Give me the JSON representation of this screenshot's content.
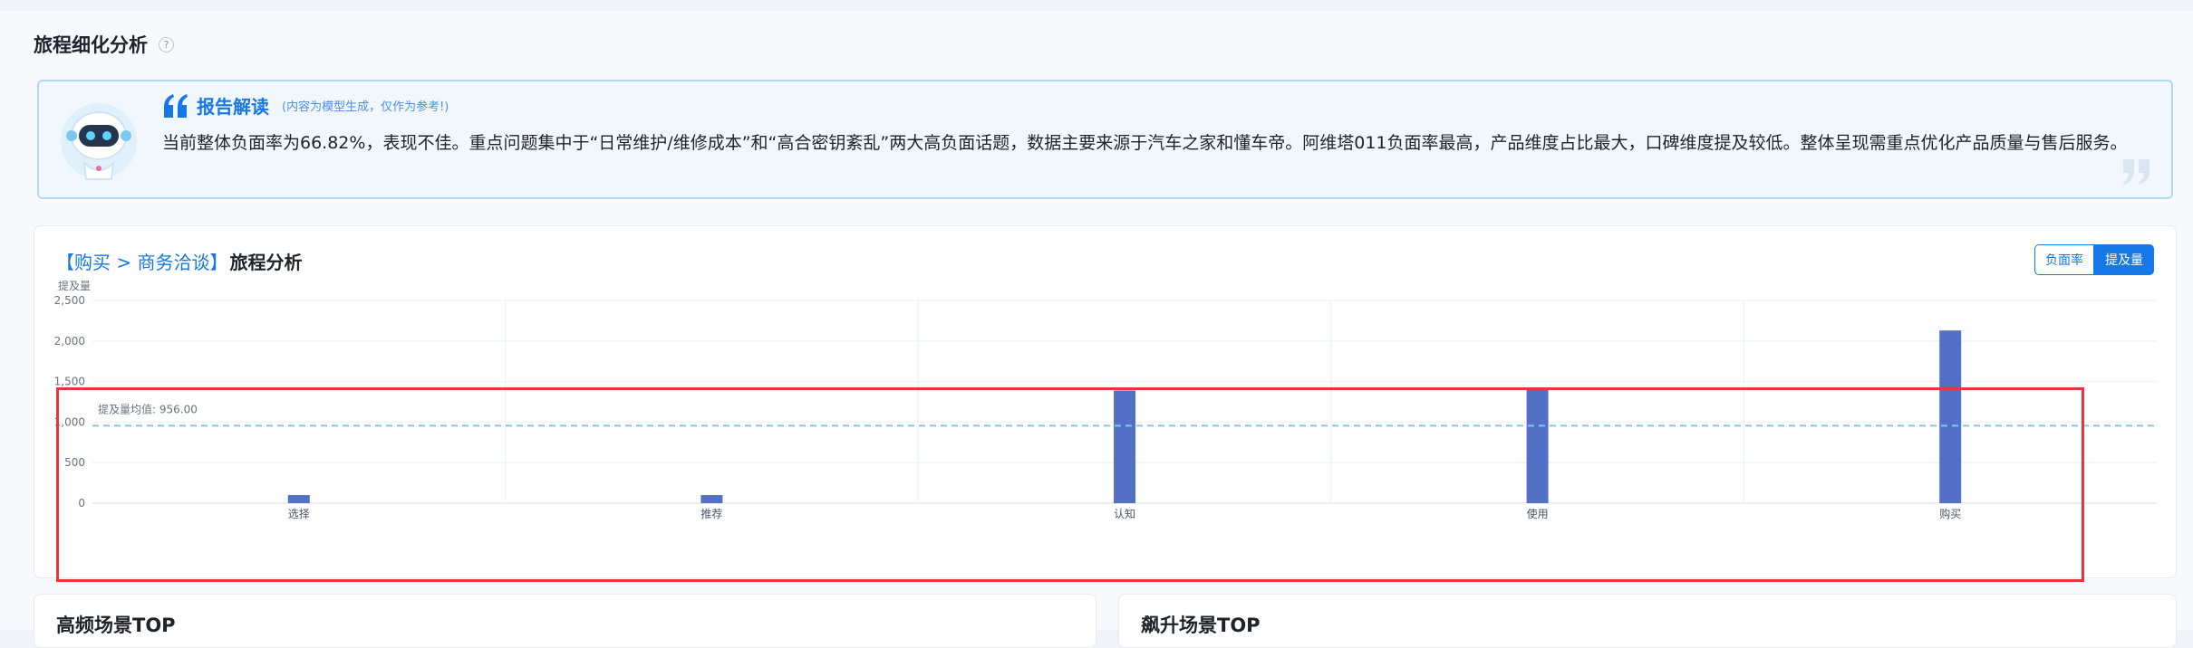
{
  "section": {
    "title": "旅程细化分析",
    "help": "?"
  },
  "report": {
    "title": "报告解读",
    "note": "(内容为模型生成，仅作为参考!)",
    "body": "当前整体负面率为66.82%，表现不佳。重点问题集中于“日常维护/维修成本”和“高合密钥紊乱”两大高负面话题，数据主要来源于汽车之家和懂车帝。阿维塔011负面率最高，产品维度占比最大，口碑维度提及较低。整体呈现需重点优化产品质量与售后服务。"
  },
  "chart_card": {
    "title_link": "【购买 > 商务洽谈】",
    "title_main": "旅程分析",
    "toggle": {
      "negative_rate": "负面率",
      "mentions": "提及量",
      "selected": "提及量"
    }
  },
  "chart_data": {
    "type": "bar",
    "ylabel": "提及量",
    "categories": [
      "选择",
      "推荐",
      "认知",
      "使用",
      "购买"
    ],
    "values": [
      100,
      100,
      1390,
      1410,
      2130
    ],
    "ylim": [
      0,
      2500
    ],
    "yticks": [
      0,
      500,
      1000,
      1500,
      2000,
      2500
    ],
    "ytick_labels": [
      "0",
      "500",
      "1,000",
      "1,500",
      "2,000",
      "2,500"
    ],
    "mean_line": {
      "value": 956,
      "label": "提及量均值: 956.00"
    },
    "bar_color": "#5470c6",
    "mean_color": "#7ec8e8",
    "grid": true
  },
  "bottom_cards": [
    {
      "title": "高频场景TOP"
    },
    {
      "title": "飙升场景TOP"
    }
  ],
  "colors": {
    "accent": "#1677e6",
    "highlight": "#e5373b"
  }
}
